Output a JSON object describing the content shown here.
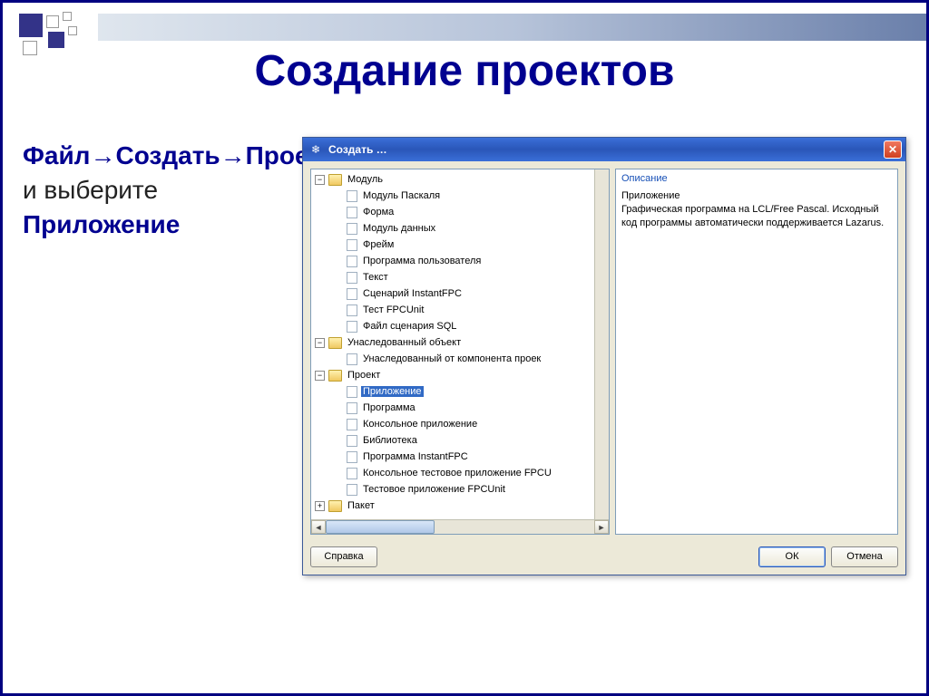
{
  "slide": {
    "title": "Создание проектов",
    "instruction_parts": {
      "p1": "Файл→Создать→Проект",
      "p2": " и выберите ",
      "p3": "Приложение"
    }
  },
  "dialog": {
    "title": "Создать …",
    "close_label": "✕",
    "buttons": {
      "help": "Справка",
      "ok": "ОК",
      "cancel": "Отмена"
    },
    "description": {
      "header": "Описание",
      "body": "Приложение\nГрафическая программа на LCL/Free Pascal. Исходный код программы автоматически поддерживается Lazarus."
    },
    "tree": [
      {
        "label": "Модуль",
        "type": "folder",
        "expanded": true,
        "children": [
          {
            "label": "Модуль Паскаля",
            "type": "file"
          },
          {
            "label": "Форма",
            "type": "file"
          },
          {
            "label": "Модуль данных",
            "type": "file"
          },
          {
            "label": "Фрейм",
            "type": "file"
          },
          {
            "label": "Программа пользователя",
            "type": "file"
          },
          {
            "label": "Текст",
            "type": "file"
          },
          {
            "label": "Сценарий InstantFPC",
            "type": "file"
          },
          {
            "label": "Тест FPCUnit",
            "type": "file"
          },
          {
            "label": "Файл сценария SQL",
            "type": "file"
          }
        ]
      },
      {
        "label": "Унаследованный объект",
        "type": "folder",
        "expanded": true,
        "children": [
          {
            "label": "Унаследованный от компонента проек",
            "type": "file"
          }
        ]
      },
      {
        "label": "Проект",
        "type": "folder",
        "expanded": true,
        "children": [
          {
            "label": "Приложение",
            "type": "file",
            "selected": true
          },
          {
            "label": "Программа",
            "type": "file"
          },
          {
            "label": "Консольное приложение",
            "type": "file"
          },
          {
            "label": "Библиотека",
            "type": "file"
          },
          {
            "label": "Программа InstantFPC",
            "type": "file"
          },
          {
            "label": "Консольное тестовое приложение FPCU",
            "type": "file"
          },
          {
            "label": "Тестовое приложение FPCUnit",
            "type": "file"
          }
        ]
      },
      {
        "label": "Пакет",
        "type": "folder",
        "expanded": false,
        "children": []
      }
    ]
  }
}
